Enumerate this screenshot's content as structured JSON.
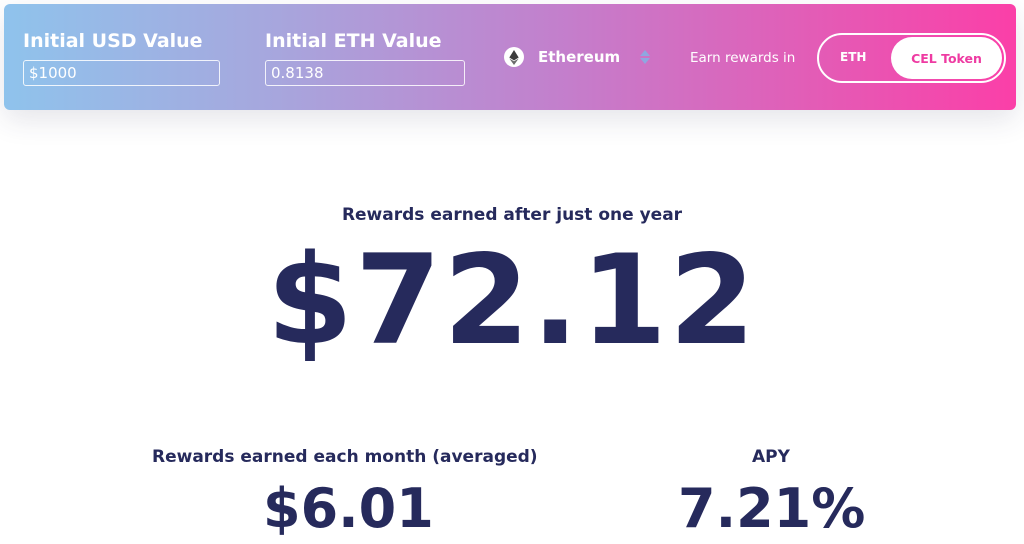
{
  "header": {
    "usd_label": "Initial USD Value",
    "usd_value": "$1000",
    "eth_label": "Initial ETH Value",
    "eth_value": "0.8138",
    "coin": {
      "name": "Ethereum",
      "icon": "ethereum-icon",
      "selector_icon": "up-down-arrows-icon"
    },
    "earn_label": "Earn rewards in",
    "toggle": {
      "options": [
        "ETH",
        "CEL Token"
      ],
      "selected": "CEL Token"
    }
  },
  "result": {
    "headline": "Rewards earned after just one year",
    "amount": "$72.12"
  },
  "stats": {
    "monthly_label": "Rewards earned each month (averaged)",
    "monthly_value": "$6.01",
    "apy_label": "APY",
    "apy_value": "7.21%"
  },
  "colors": {
    "gradient_start": "#8fc3ec",
    "gradient_end": "#fb3fa8",
    "text_navy": "#262a5c",
    "accent_pink": "#ee3ba2"
  }
}
